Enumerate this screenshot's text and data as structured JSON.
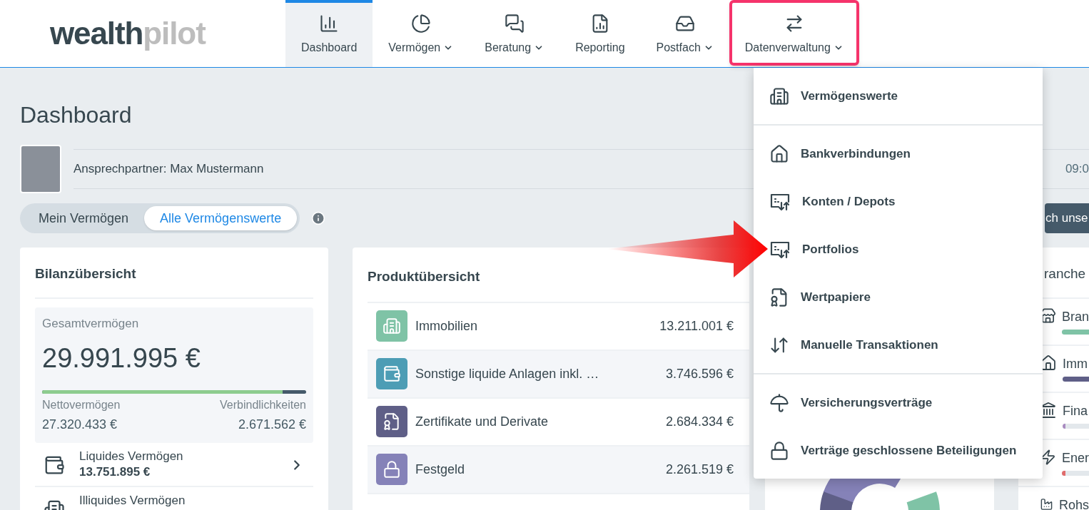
{
  "logo": {
    "strong": "wealth",
    "light": "pilot"
  },
  "nav": [
    {
      "kind": "dashboard",
      "label": "Dashboard",
      "selected": true,
      "has_menu": false,
      "highlighted": false
    },
    {
      "kind": "pie",
      "label": "Vermögen",
      "selected": false,
      "has_menu": true,
      "highlighted": false
    },
    {
      "kind": "chat",
      "label": "Beratung",
      "selected": false,
      "has_menu": true,
      "highlighted": false
    },
    {
      "kind": "report",
      "label": "Reporting",
      "selected": false,
      "has_menu": false,
      "highlighted": false
    },
    {
      "kind": "inbox",
      "label": "Postfach",
      "selected": false,
      "has_menu": true,
      "highlighted": false
    },
    {
      "kind": "data",
      "label": "Datenverwaltung",
      "selected": false,
      "has_menu": true,
      "highlighted": true
    }
  ],
  "page_title": "Dashboard",
  "contact": {
    "label": "Ansprechpartner:",
    "name": "Max Mustermann",
    "time": "09:0"
  },
  "scope_toggle": [
    {
      "label": "Mein Vermögen",
      "selected": false
    },
    {
      "label": "Alle Vermögenswerte",
      "selected": true
    }
  ],
  "cta_button": "ch unse",
  "balance": {
    "title": "Bilanzübersicht",
    "total_label": "Gesamtvermögen",
    "total": "29.991.995 €",
    "level": 0.91,
    "net_label": "Nettovermögen",
    "net": "27.320.433 €",
    "liabilities_label": "Verbindlichkeiten",
    "liabilities": "2.671.562 €",
    "categories": [
      {
        "kind": "wallet",
        "label": "Liquides Vermögen",
        "value": "13.751.895 €"
      },
      {
        "kind": "building",
        "label": "Illiquides Vermögen"
      }
    ]
  },
  "products": {
    "title": "Produktübersicht",
    "rows": [
      {
        "kind": "building",
        "name": "Immobilien",
        "value": "13.211.001 €",
        "color": "#7fc3a6"
      },
      {
        "kind": "wallet",
        "name": "Sonstige liquide Anlagen inkl. …",
        "value": "3.746.596 €",
        "color": "#4d9db5"
      },
      {
        "kind": "certificate",
        "name": "Zertifikate und Derivate",
        "value": "2.684.334 €",
        "color": "#5f5f87"
      },
      {
        "kind": "deposit",
        "name": "Festgeld",
        "value": "2.261.519 €",
        "color": "#8582b8"
      }
    ]
  },
  "sectors": {
    "title": "ranche",
    "rows": [
      {
        "kind": "store",
        "name": "Bran",
        "level": 1,
        "color": "#7fc3a6"
      },
      {
        "kind": "house",
        "name": "Imm",
        "level": 1,
        "color": "#5f5f87"
      },
      {
        "kind": "bank",
        "name": "Fina",
        "level": 0.12,
        "color": "#a98bc0"
      },
      {
        "kind": "energy",
        "name": "Ener",
        "level": 0.12,
        "color": "#e06c6c"
      },
      {
        "kind": "factory",
        "name": "Rohs"
      }
    ]
  },
  "menu": {
    "sections": [
      [
        {
          "kind": "building",
          "label": "Vermögenswerte"
        }
      ],
      [
        {
          "kind": "bank-house",
          "label": "Bankverbindungen"
        },
        {
          "kind": "transfer",
          "label": "Konten / Depots"
        },
        {
          "kind": "transfer",
          "label": "Portfolios"
        },
        {
          "kind": "certificate",
          "label": "Wertpapiere"
        },
        {
          "kind": "updown",
          "label": "Manuelle Transaktionen"
        }
      ],
      [
        {
          "kind": "umbrella",
          "label": "Versicherungsverträge"
        },
        {
          "kind": "lock",
          "label": "Verträge geschlossene Beteiligungen"
        }
      ]
    ]
  }
}
